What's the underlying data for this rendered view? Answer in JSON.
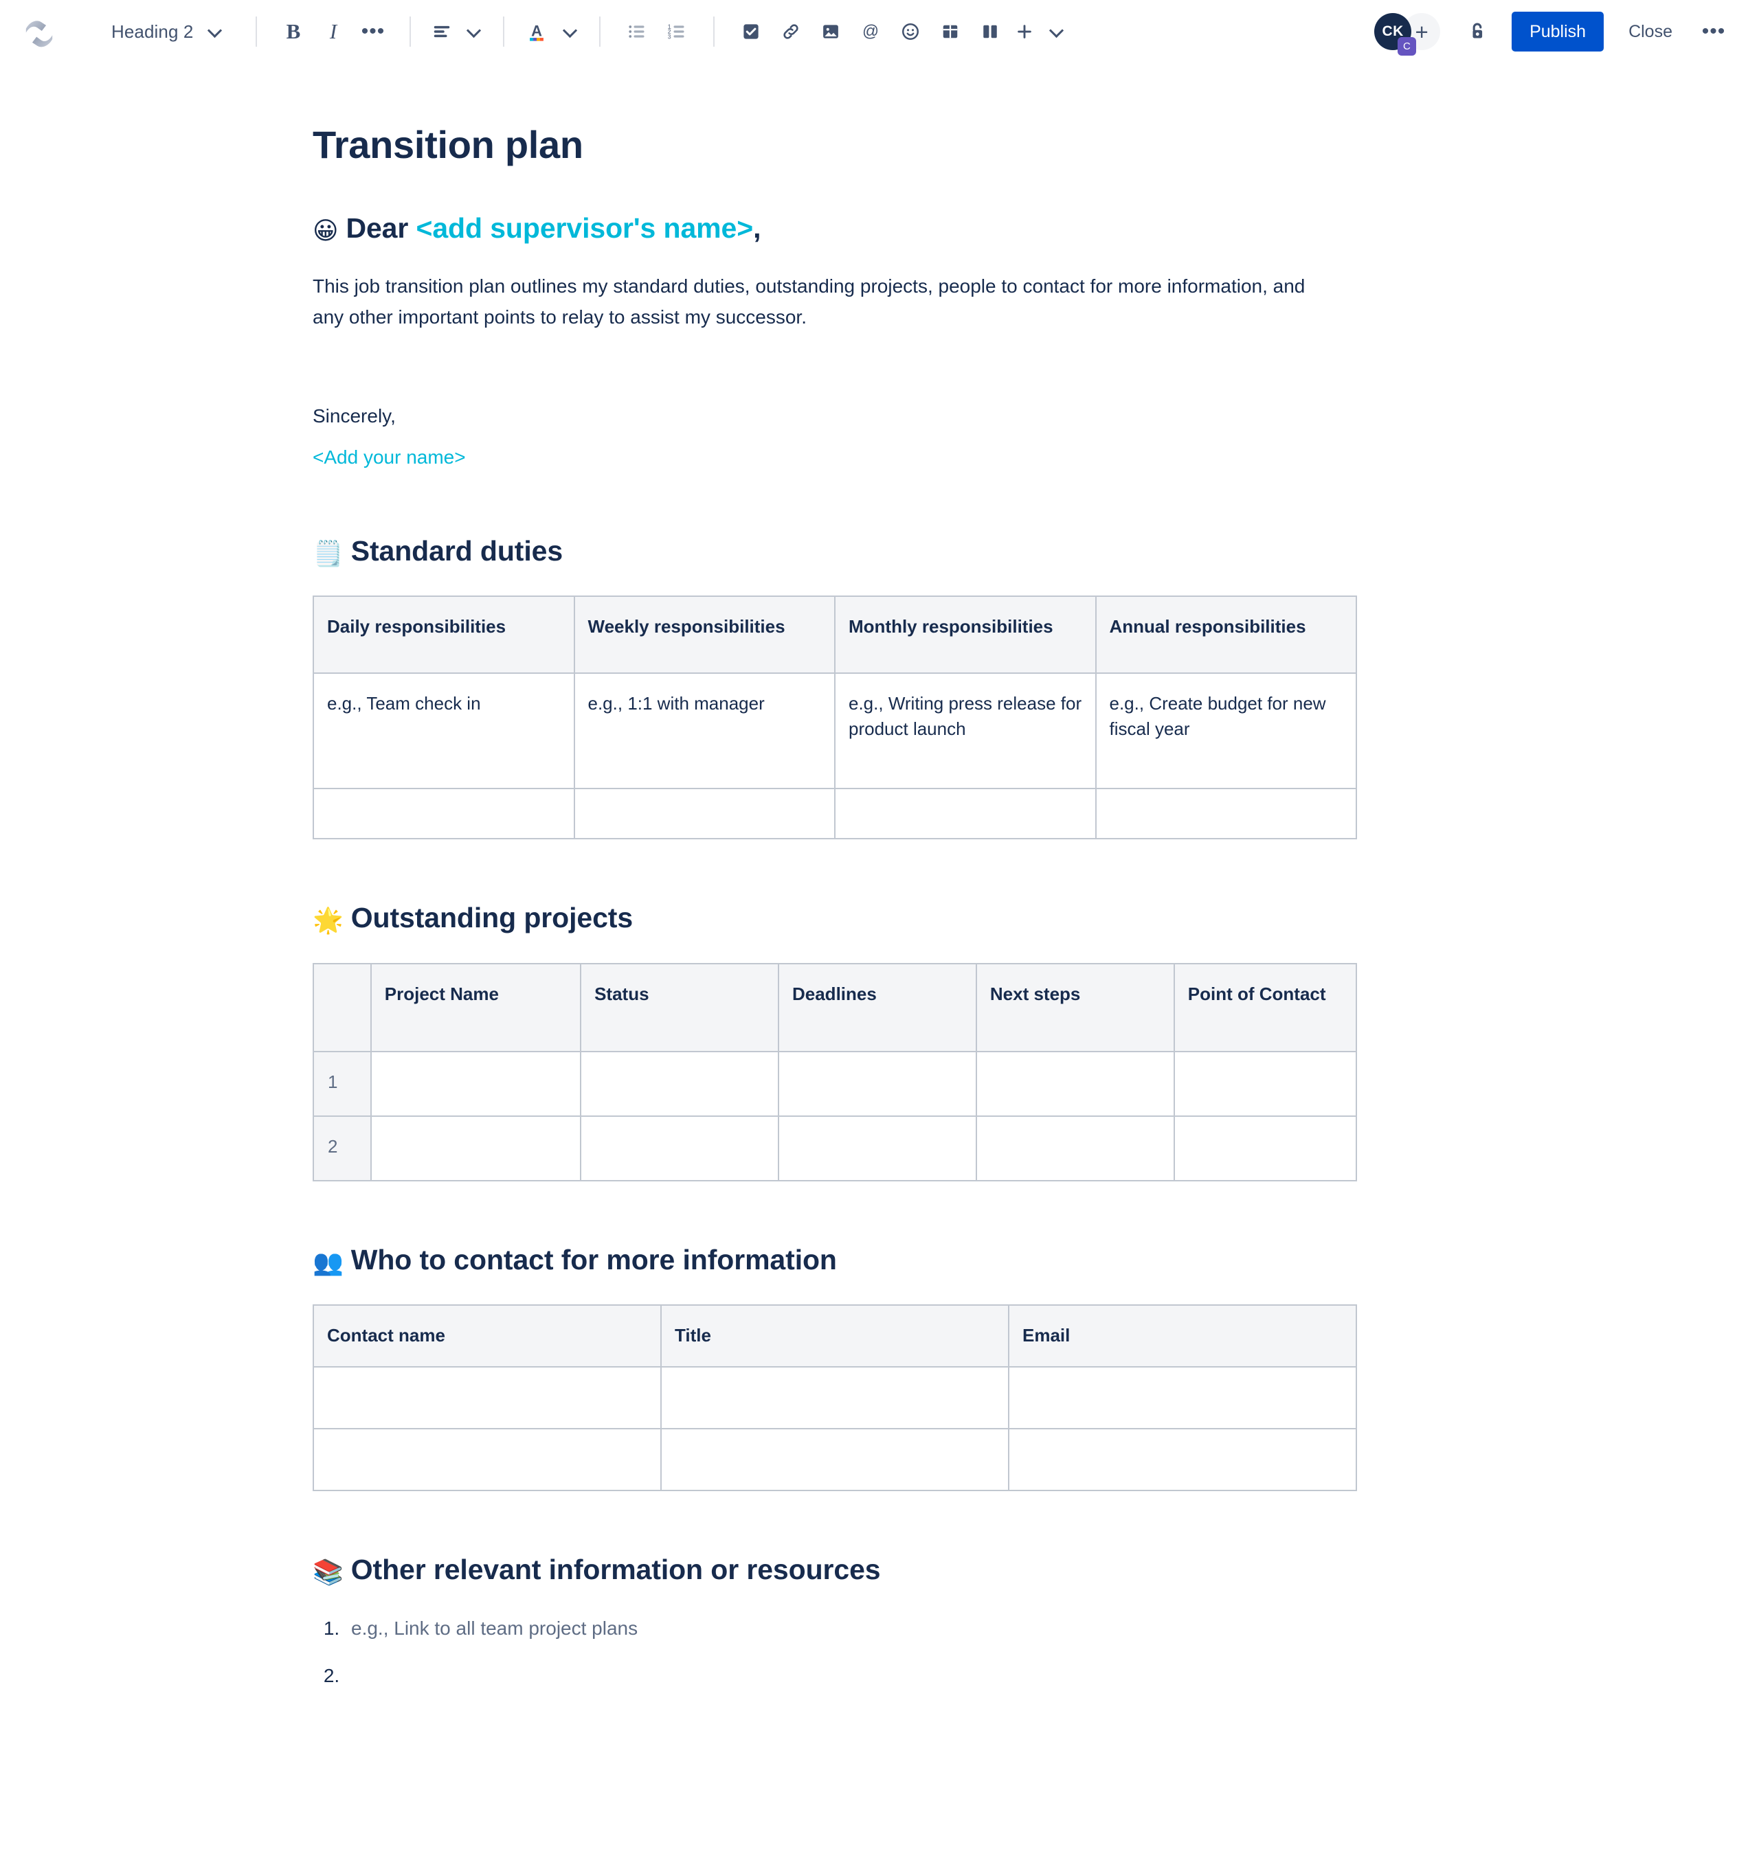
{
  "toolbar": {
    "logo_name": "confluence-logo",
    "style_select": {
      "label": "Heading 2"
    },
    "buttons": {
      "bold": "B",
      "italic": "I",
      "more_formatting": "•••",
      "text_align": "align-left-icon",
      "text_color": "A",
      "bullet_list": "bullet-list-icon",
      "numbered_list": "numbered-list-icon",
      "task_list": "task-checkbox-icon",
      "link": "link-icon",
      "image": "image-icon",
      "mention": "@",
      "emoji": "emoji-icon",
      "table": "table-icon",
      "layout": "layout-columns-icon",
      "insert_more": "+"
    },
    "avatar": {
      "initials": "CK",
      "badge": "C"
    },
    "add_people_label": "+",
    "lock_icon": "unlocked-padlock-icon",
    "publish_label": "Publish",
    "close_label": "Close",
    "more_options_label": "•••"
  },
  "document": {
    "title": "Transition plan",
    "greeting": {
      "emoji": "😀",
      "text": "Dear ",
      "placeholder": "<add supervisor's name>",
      "suffix": ","
    },
    "intro": "This job transition plan outlines my standard duties, outstanding projects, people to contact for more information, and any other important points to relay to assist my successor.",
    "signoff": "Sincerely,",
    "signature_placeholder": "<Add your name>",
    "sections": {
      "standard_duties": {
        "emoji": "🗒️",
        "heading": "Standard duties",
        "table": {
          "headers": [
            "Daily responsibilities",
            "Weekly responsibilities",
            "Monthly responsibilities",
            "Annual responsibilities"
          ],
          "rows": [
            [
              "e.g., Team check in",
              "e.g., 1:1 with manager",
              "e.g., Writing press release for product launch",
              "e.g., Create budget for new fiscal year"
            ],
            [
              "",
              "",
              "",
              ""
            ]
          ]
        }
      },
      "outstanding_projects": {
        "emoji": "🌟",
        "heading": "Outstanding projects",
        "table": {
          "headers": [
            "",
            "Project Name",
            "Status",
            "Deadlines",
            "Next steps",
            "Point of Contact"
          ],
          "rows": [
            [
              "1",
              "",
              "",
              "",
              "",
              ""
            ],
            [
              "2",
              "",
              "",
              "",
              "",
              ""
            ]
          ]
        }
      },
      "who_to_contact": {
        "emoji": "👥",
        "heading": "Who to contact for more information",
        "table": {
          "headers": [
            "Contact name",
            "Title",
            "Email"
          ],
          "rows": [
            [
              "",
              "",
              ""
            ],
            [
              "",
              "",
              ""
            ]
          ]
        }
      },
      "other_resources": {
        "emoji": "📚",
        "heading": "Other relevant information or resources",
        "items": [
          "e.g., Link to all team project plans",
          ""
        ]
      }
    }
  },
  "colors": {
    "accent_blue": "#0052CC",
    "placeholder_cyan": "#00B8D9",
    "text_dark": "#172B4D",
    "text_subtle": "#5E6C84",
    "header_gray": "#F4F5F7",
    "header_blue": "#DEEBFF",
    "border": "#C1C7D0",
    "badge_purple": "#6554C0"
  }
}
